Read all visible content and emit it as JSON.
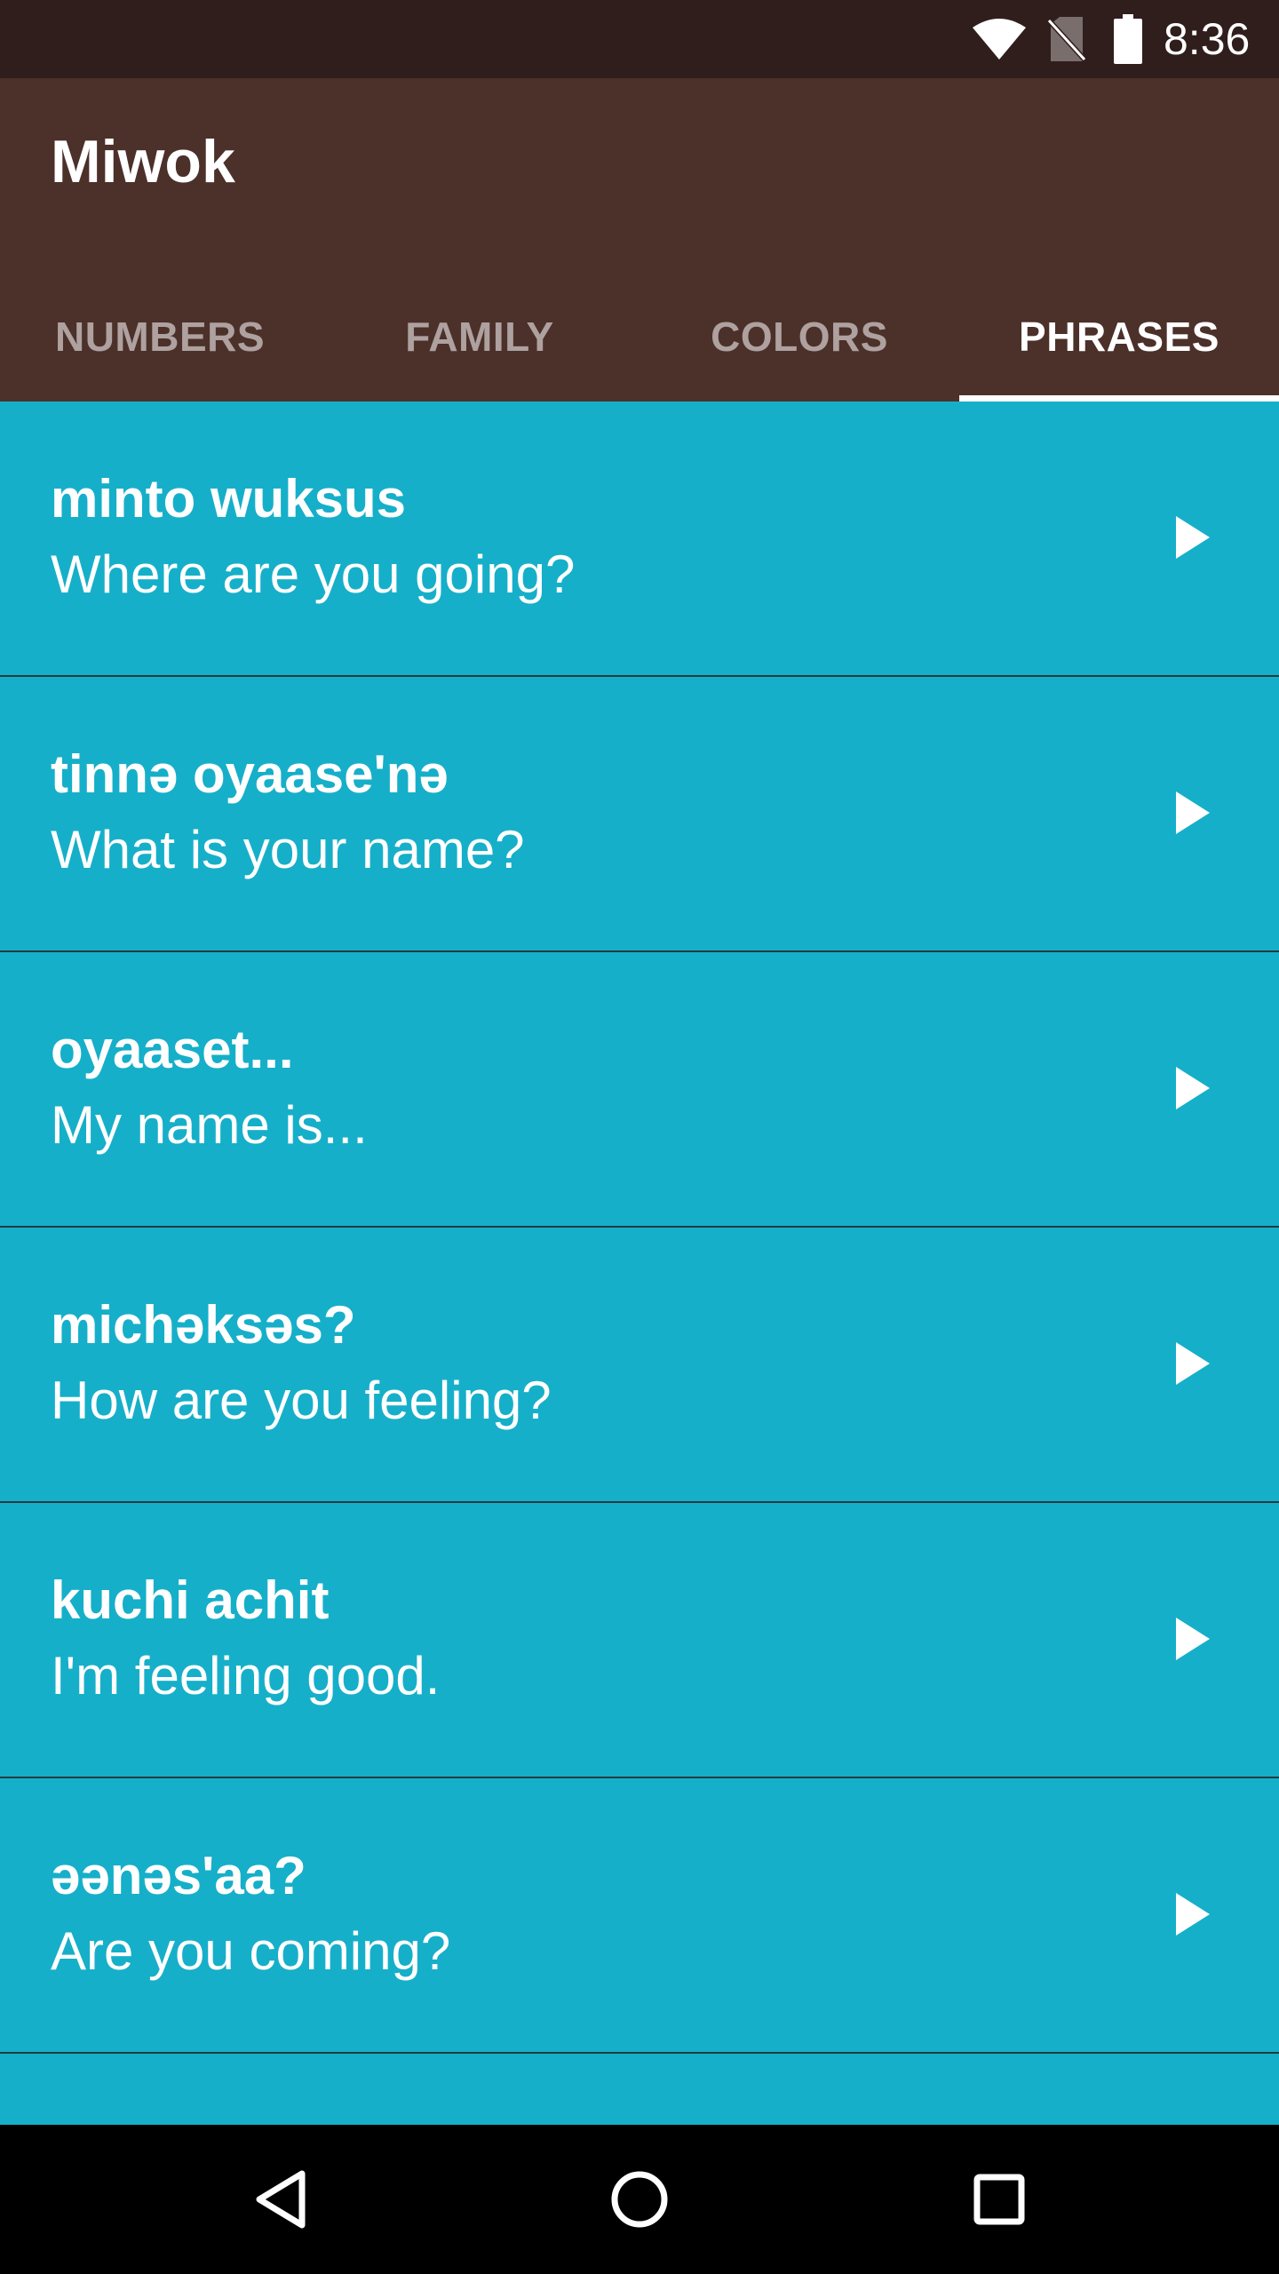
{
  "status_bar": {
    "time": "8:36",
    "icons": [
      "wifi-icon",
      "no-sim-icon",
      "battery-icon"
    ]
  },
  "app_bar": {
    "title": "Miwok",
    "tabs": [
      {
        "label": "NUMBERS",
        "active": false
      },
      {
        "label": "FAMILY",
        "active": false
      },
      {
        "label": "COLORS",
        "active": false
      },
      {
        "label": "PHRASES",
        "active": true
      }
    ]
  },
  "phrases": [
    {
      "miwok": "minto wuksus",
      "english": "Where are you going?"
    },
    {
      "miwok": "tinnә oyaase'nә",
      "english": "What is your name?"
    },
    {
      "miwok": "oyaaset...",
      "english": "My name is..."
    },
    {
      "miwok": "michәksәs?",
      "english": "How are you feeling?"
    },
    {
      "miwok": "kuchi achit",
      "english": "I'm feeling good."
    },
    {
      "miwok": "әәnәs'aa?",
      "english": "Are you coming?"
    },
    {
      "miwok": "",
      "english": ""
    }
  ],
  "nav_bar": {
    "buttons": [
      "back-icon",
      "home-icon",
      "recents-icon"
    ]
  },
  "colors": {
    "status_bar": "#301E1C",
    "app_bar": "#4C302A",
    "list_background": "#16AFC9",
    "divider": "#1E3B40"
  }
}
